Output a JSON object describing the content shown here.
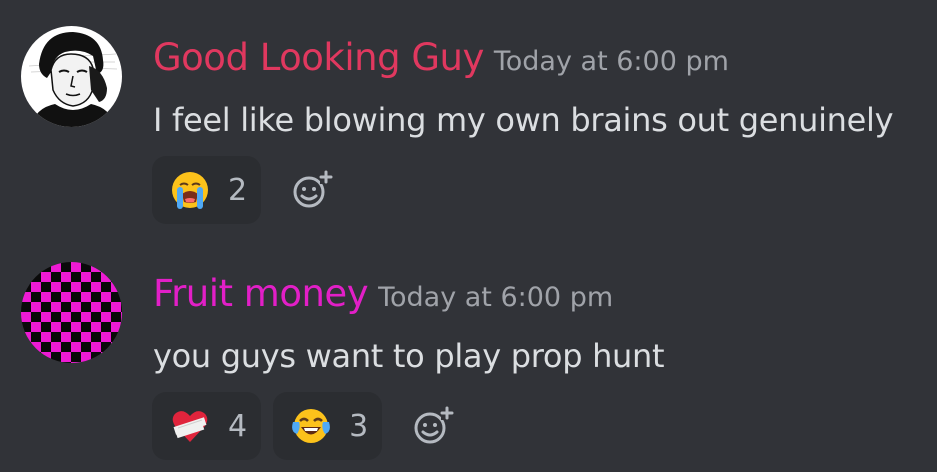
{
  "colors": {
    "background": "#313338",
    "reaction_bg": "#2b2d31",
    "username_1": "#e0385f",
    "username_2": "#e21fc7",
    "timestamp": "#a0a3a9",
    "message_text": "#dbdee1"
  },
  "messages": [
    {
      "username": "Good Looking Guy",
      "timestamp": "Today at 6:00 pm",
      "text": "I feel like blowing my own brains out genuinely",
      "reactions": [
        {
          "emoji": "loudly-crying-face",
          "count": "2"
        }
      ]
    },
    {
      "username": "Fruit money",
      "timestamp": "Today at 6:00 pm",
      "text": "you guys want to play prop hunt",
      "reactions": [
        {
          "emoji": "mending-heart",
          "count": "4"
        },
        {
          "emoji": "face-with-tears-of-joy",
          "count": "3"
        }
      ]
    }
  ]
}
